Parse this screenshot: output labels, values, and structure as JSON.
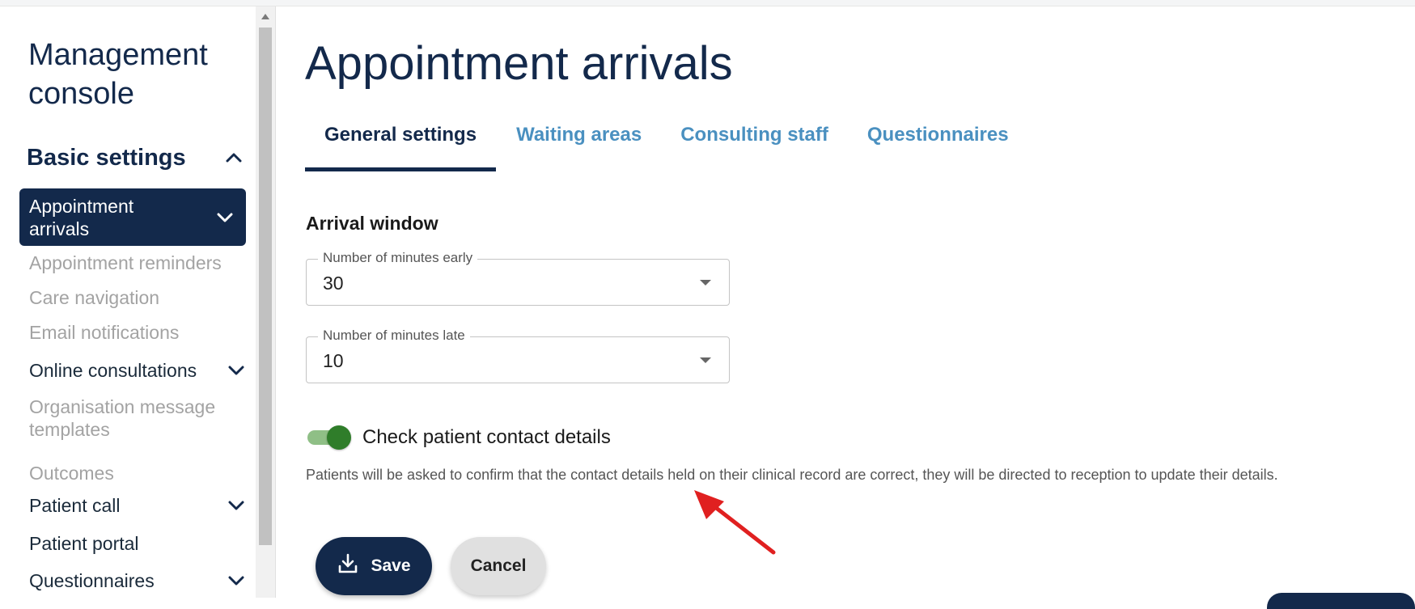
{
  "sidebar": {
    "title": "Management console",
    "section": {
      "label": "Basic settings",
      "icon": "chevron-up-icon"
    },
    "active_item": {
      "label": "Appointment arrivals",
      "icon": "chevron-down-icon"
    },
    "items": [
      {
        "label": "Appointment reminders",
        "state": "disabled"
      },
      {
        "label": "Care navigation",
        "state": "disabled"
      },
      {
        "label": "Email notifications",
        "state": "disabled"
      },
      {
        "label": "Online consultations",
        "state": "enabled",
        "icon": "chevron-down-icon"
      },
      {
        "label": "Organisation message templates",
        "state": "disabled"
      },
      {
        "label": "Outcomes",
        "state": "disabled"
      },
      {
        "label": "Patient call",
        "state": "enabled",
        "icon": "chevron-down-icon"
      },
      {
        "label": "Patient portal",
        "state": "enabled"
      },
      {
        "label": "Questionnaires",
        "state": "enabled",
        "icon": "chevron-down-icon"
      }
    ]
  },
  "main": {
    "title": "Appointment arrivals",
    "tabs": [
      {
        "label": "General settings",
        "active": true
      },
      {
        "label": "Waiting areas",
        "active": false
      },
      {
        "label": "Consulting staff",
        "active": false
      },
      {
        "label": "Questionnaires",
        "active": false
      }
    ],
    "arrival_window": {
      "heading": "Arrival window",
      "early": {
        "label": "Number of minutes early",
        "value": "30"
      },
      "late": {
        "label": "Number of minutes late",
        "value": "10"
      }
    },
    "contact_check": {
      "label": "Check patient contact details",
      "enabled": true,
      "help": "Patients will be asked to confirm that the contact details held on their clinical record are correct, they will be directed to reception to update their details."
    },
    "actions": {
      "save_label": "Save",
      "save_icon": "download-icon",
      "cancel_label": "Cancel"
    }
  },
  "colors": {
    "navy": "#13294b",
    "tab_link": "#4a90c0",
    "toggle_on": "#2f7d2a",
    "annotation_arrow": "#e02020"
  }
}
